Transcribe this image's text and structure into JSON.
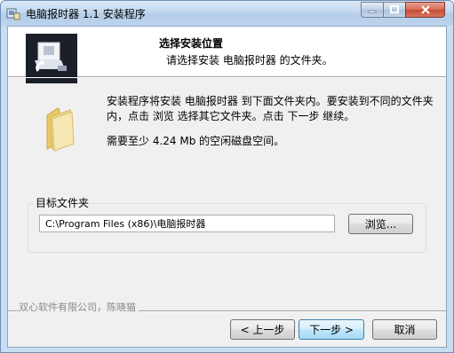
{
  "window": {
    "title": "电脑报时器 1.1 安装程序",
    "controls": {
      "minimize": "–",
      "maximize": "□",
      "close": "✕"
    }
  },
  "header": {
    "title": "选择安装位置",
    "subtitle": "请选择安装 电脑报时器 的文件夹。"
  },
  "body": {
    "description": "安装程序将安装 电脑报时器 到下面文件夹内。要安装到不同的文件夹内，点击 浏览 选择其它文件夹。点击 下一步 继续。",
    "space_required": "需要至少 4.24 Mb 的空闲磁盘空间。"
  },
  "destination": {
    "group_label": "目标文件夹",
    "path_value": "C:\\Program Files (x86)\\电脑报时器",
    "browse_label": "浏览..."
  },
  "footer": {
    "branding": "双心软件有限公司，陈晓猫",
    "back_label": "< 上一步",
    "next_label": "下一步 >",
    "cancel_label": "取消"
  },
  "icons": {
    "app": "installer-icon",
    "header": "install-disk-logo-icon",
    "folder": "folder-icon"
  },
  "colors": {
    "titlebar": "#c3d8ee",
    "client_bg": "#f0f0f0",
    "close_button": "#d66a55"
  }
}
